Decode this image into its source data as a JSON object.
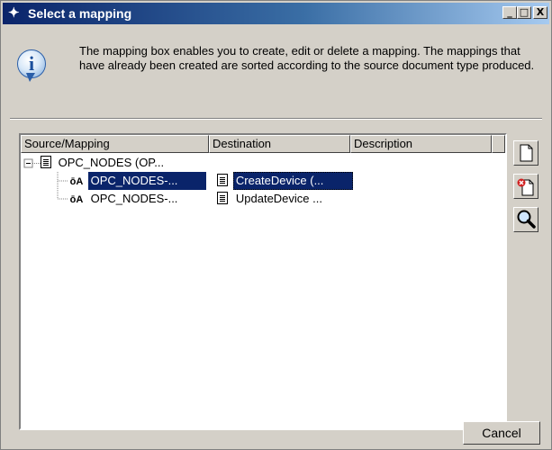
{
  "window": {
    "title": "Select a mapping",
    "minimize": "_",
    "maximize": "□",
    "close": "X"
  },
  "info": {
    "text": "The mapping box enables you to create, edit or delete a mapping. The mappings that have already been created are sorted according to the source document type produced."
  },
  "table": {
    "columns": [
      "Source/Mapping",
      "Destination",
      "Description"
    ],
    "root": {
      "label": "OPC_NODES (OP..."
    },
    "rows": [
      {
        "source": "OPC_NODES-...",
        "destination": "CreateDevice (...",
        "selected": true
      },
      {
        "source": "OPC_NODES-...",
        "destination": "UpdateDevice ...",
        "selected": false
      }
    ]
  },
  "buttons": {
    "cancel": "Cancel"
  },
  "icons": {
    "title": "app-star-icon",
    "info": "info-icon",
    "new": "new-document-icon",
    "delete": "delete-document-icon",
    "view": "magnifier-icon"
  },
  "colors": {
    "title_bar": "#0a246a",
    "selection": "#0a246a",
    "face": "#d4d0c8"
  }
}
